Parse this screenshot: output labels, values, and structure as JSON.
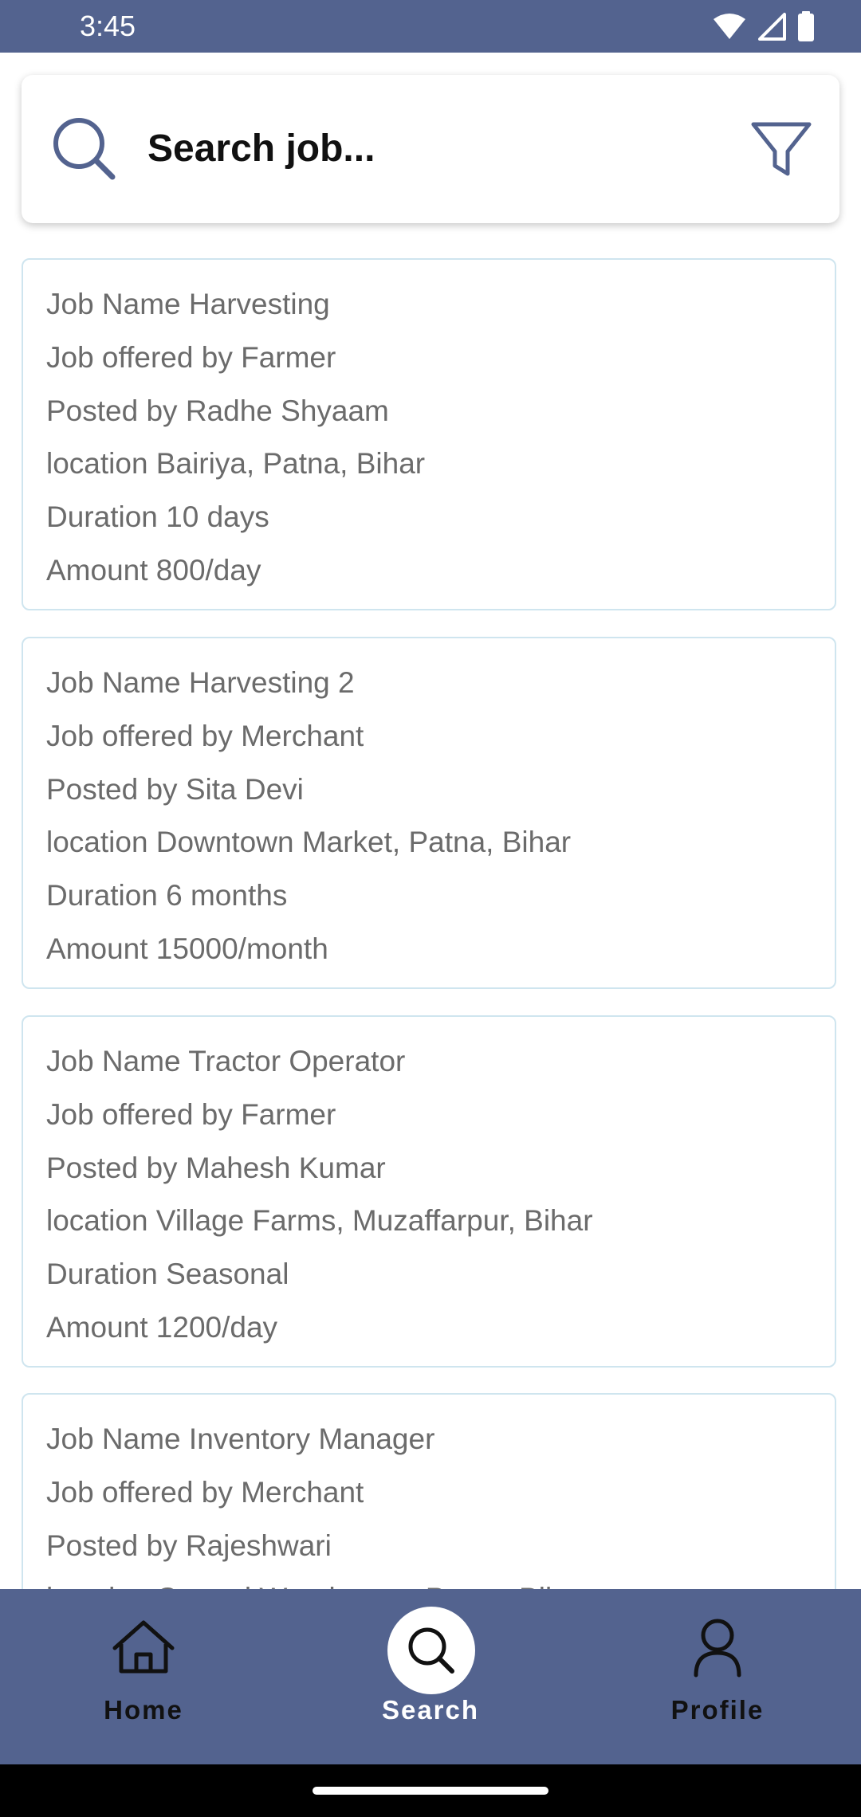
{
  "status_bar": {
    "time": "3:45",
    "icons": [
      "wifi-icon",
      "signal-icon",
      "battery-icon"
    ]
  },
  "search": {
    "placeholder": "Search job...",
    "value": "",
    "icon": "search-icon",
    "filter_icon": "filter-icon"
  },
  "jobs": [
    {
      "name": "Job Name Harvesting",
      "offered_by": "Job offered by Farmer",
      "posted_by": "Posted by Radhe Shyaam",
      "location": "location Bairiya, Patna, Bihar",
      "duration": "Duration 10 days",
      "amount": "Amount 800/day"
    },
    {
      "name": "Job Name Harvesting 2",
      "offered_by": "Job offered by Merchant",
      "posted_by": "Posted by Sita Devi",
      "location": "location Downtown Market, Patna, Bihar",
      "duration": "Duration 6 months",
      "amount": "Amount 15000/month"
    },
    {
      "name": "Job Name Tractor Operator",
      "offered_by": "Job offered by Farmer",
      "posted_by": "Posted by Mahesh Kumar",
      "location": "location Village Farms, Muzaffarpur, Bihar",
      "duration": "Duration Seasonal",
      "amount": "Amount 1200/day"
    },
    {
      "name": "Job Name Inventory Manager",
      "offered_by": "Job offered by Merchant",
      "posted_by": "Posted by Rajeshwari",
      "location": "location Central Warehouse, Patna, Bihar"
    }
  ],
  "nav": {
    "home": "Home",
    "search": "Search",
    "profile": "Profile",
    "active": "search"
  },
  "colors": {
    "primary": "#53638f",
    "card_border": "#cfe5ef",
    "text_muted": "#6b6b6b"
  }
}
